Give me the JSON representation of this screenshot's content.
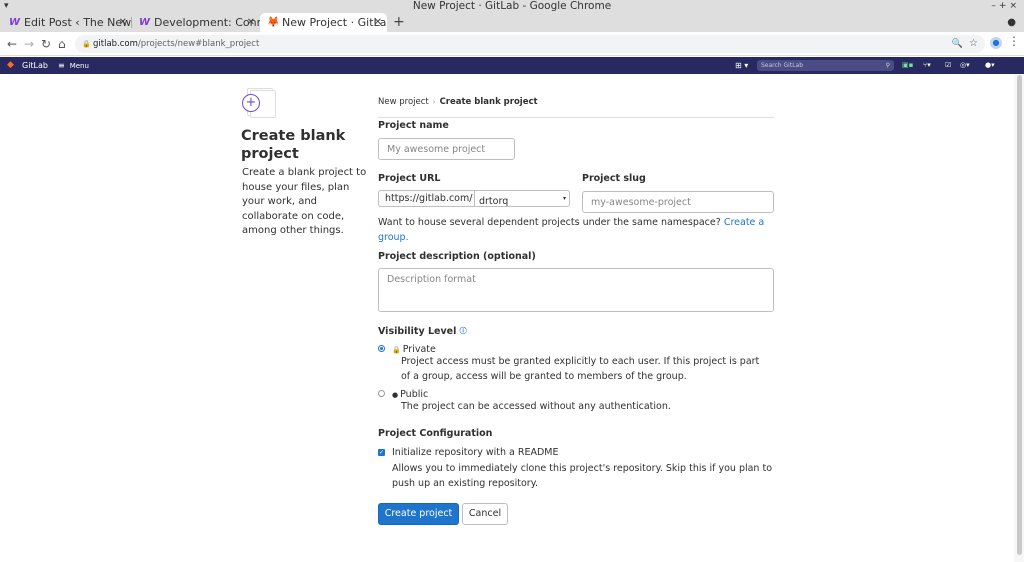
{
  "browser": {
    "window_title": "New Project · GitLab - Google Chrome",
    "tabs": [
      {
        "label": "Edit Post ‹ The New",
        "favicon": "W"
      },
      {
        "label": "Development: Conn",
        "favicon": "W"
      },
      {
        "label": "New Project · GitLab",
        "favicon": "gitlab-fox"
      }
    ],
    "new_tab_label": "+",
    "url_host": "gitlab.com",
    "url_path": "/projects/new#blank_project"
  },
  "gitlab_nav": {
    "brand": "GitLab",
    "menu_label": "Menu",
    "search_placeholder": "Search GitLab"
  },
  "page": {
    "left": {
      "title": "Create blank project",
      "description": "Create a blank project to house your files, plan your work, and collaborate on code, among other things."
    },
    "breadcrumb": {
      "parent": "New project",
      "current": "Create blank project"
    },
    "project_name": {
      "label": "Project name",
      "placeholder": "My awesome project"
    },
    "project_url": {
      "label": "Project URL",
      "prefix": "https://gitlab.com/",
      "namespace": "drtorq"
    },
    "project_slug": {
      "label": "Project slug",
      "placeholder": "my-awesome-project"
    },
    "namespace_help": {
      "text": "Want to house several dependent projects under the same namespace?",
      "link": "Create a group."
    },
    "description": {
      "label": "Project description (optional)",
      "placeholder": "Description format"
    },
    "visibility": {
      "label": "Visibility Level",
      "options": [
        {
          "label": "Private",
          "description": "Project access must be granted explicitly to each user. If this project is part of a group, access will be granted to members of the group.",
          "checked": true
        },
        {
          "label": "Public",
          "description": "The project can be accessed without any authentication.",
          "checked": false
        }
      ]
    },
    "configuration": {
      "label": "Project Configuration",
      "readme_label": "Initialize repository with a README",
      "readme_checked": true,
      "readme_help": "Allows you to immediately clone this project's repository. Skip this if you plan to push up an existing repository."
    },
    "buttons": {
      "create": "Create project",
      "cancel": "Cancel"
    }
  },
  "colors": {
    "gitlab_nav_bg": "#292961",
    "primary_button": "#1f75cb",
    "link": "#1f75cb"
  }
}
